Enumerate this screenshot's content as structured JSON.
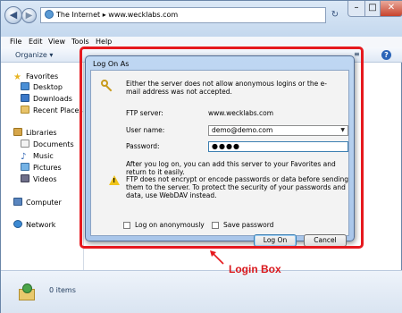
{
  "window": {
    "address": "The Internet ▸ www.wecklabs.com",
    "controls": {
      "minimize": "–",
      "maximize": "□",
      "close": "✕"
    },
    "nav_back": "◀",
    "nav_forward": "▶",
    "refresh": "↻"
  },
  "menu": [
    "File",
    "Edit",
    "View",
    "Tools",
    "Help"
  ],
  "toolbar": {
    "organize": "Organize ▾",
    "view_icon": "≡",
    "help": "?"
  },
  "sidebar": {
    "favorites": "Favorites",
    "favorite_items": [
      "Desktop",
      "Downloads",
      "Recent Places"
    ],
    "libraries": "Libraries",
    "library_items": [
      "Documents",
      "Music",
      "Pictures",
      "Videos"
    ],
    "computer": "Computer",
    "network": "Network"
  },
  "status": {
    "items": "0 items"
  },
  "dialog": {
    "title": "Log On As",
    "message": "Either the server does not allow anonymous logins or the e-mail address was not accepted.",
    "ftp_server_label": "FTP server:",
    "ftp_server_value": "www.wecklabs.com",
    "username_label": "User name:",
    "username_value": "demo@demo.com",
    "password_label": "Password:",
    "password_value": "●●●●",
    "info": "After you log on, you can add this server to your Favorites and return to it easily.",
    "warning": "FTP does not encrypt or encode passwords or data before sending them to the server.  To protect the security of your passwords and data, use WebDAV instead.",
    "anon_label": "Log on anonymously",
    "save_label": "Save password",
    "logon_button": "Log On",
    "cancel_button": "Cancel"
  },
  "annotation": {
    "label": "Login Box",
    "color": "#e6191e"
  }
}
